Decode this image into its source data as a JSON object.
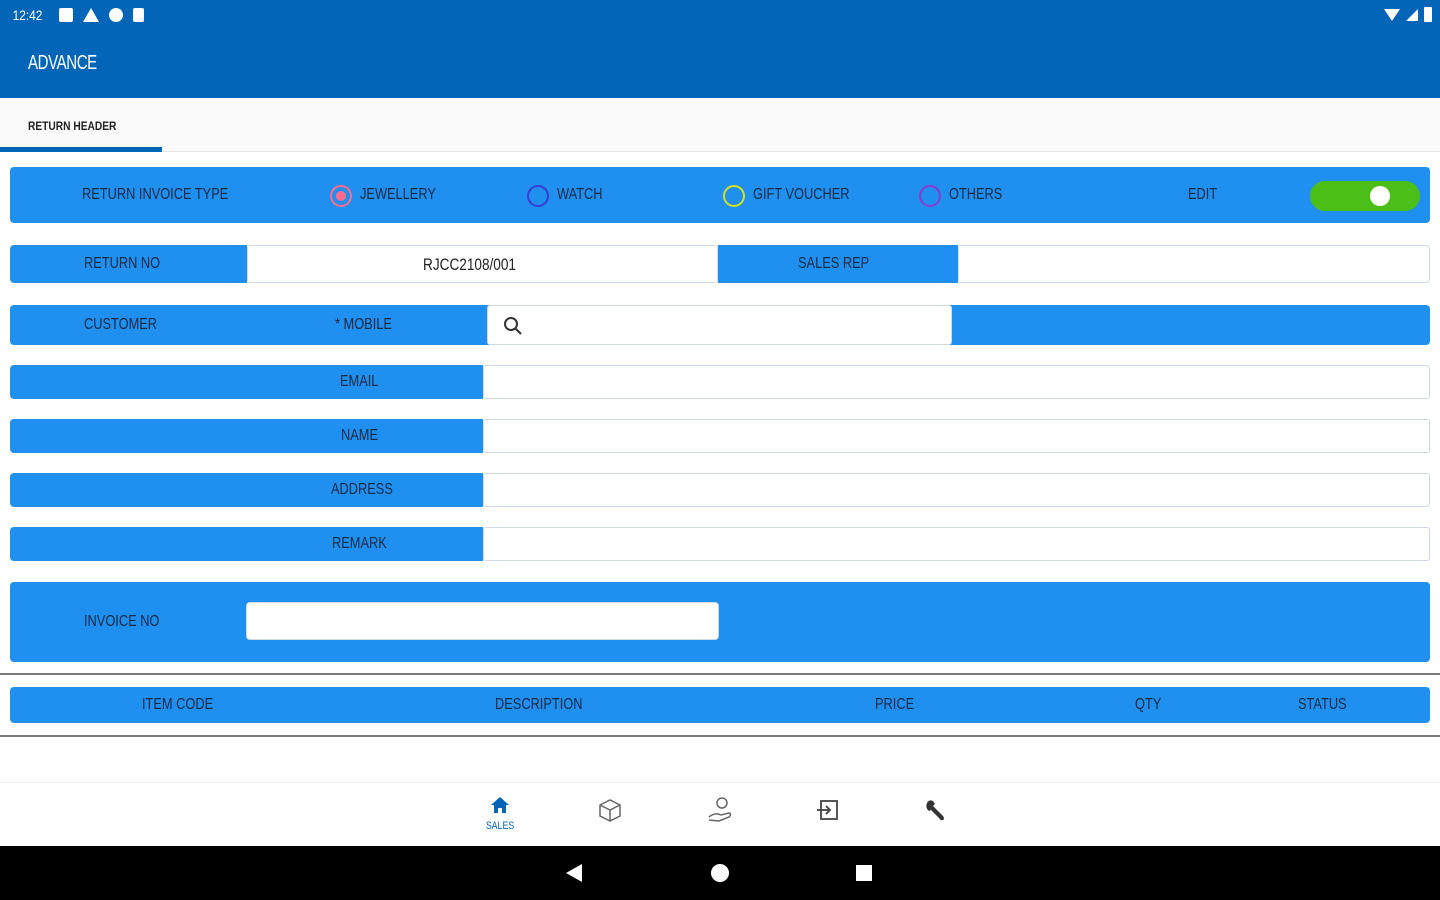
{
  "status": {
    "time": "12:42"
  },
  "app": {
    "title": "ADVANCE"
  },
  "tabs": [
    {
      "label": "RETURN HEADER",
      "active": true
    }
  ],
  "invoice_type": {
    "label": "RETURN INVOICE TYPE",
    "options": [
      {
        "label": "JEWELLERY",
        "selected": true,
        "color": "#ff6b8a"
      },
      {
        "label": "WATCH",
        "selected": false,
        "color": "#3b3bd0"
      },
      {
        "label": "GIFT VOUCHER",
        "selected": false,
        "color": "#d8e020"
      },
      {
        "label": "OTHERS",
        "selected": false,
        "color": "#8a3bd0"
      }
    ],
    "edit_label": "EDIT",
    "edit_on": true
  },
  "return_no": {
    "label": "RETURN NO",
    "value": "RJCC2108/001"
  },
  "sales_rep": {
    "label": "SALES REP",
    "value": ""
  },
  "customer": {
    "label": "CUSTOMER",
    "mobile_label": "* MOBILE",
    "mobile_value": ""
  },
  "fields": [
    {
      "label": "EMAIL",
      "value": ""
    },
    {
      "label": "NAME",
      "value": ""
    },
    {
      "label": "ADDRESS",
      "value": ""
    },
    {
      "label": "REMARK",
      "value": ""
    }
  ],
  "invoice_no": {
    "label": "INVOICE NO",
    "value": ""
  },
  "items_table": {
    "columns": [
      "ITEM CODE",
      "DESCRIPTION",
      "PRICE",
      "QTY",
      "STATUS"
    ]
  },
  "bottom_nav": [
    {
      "icon": "home-icon",
      "label": "SALES",
      "active": true
    },
    {
      "icon": "box-icon",
      "label": ""
    },
    {
      "icon": "user-hand-icon",
      "label": ""
    },
    {
      "icon": "logout-icon",
      "label": ""
    },
    {
      "icon": "wrench-icon",
      "label": ""
    }
  ],
  "colors": {
    "primary": "#0265b8",
    "row_blue": "#1f8ff0",
    "toggle_on": "#4bbf17"
  }
}
